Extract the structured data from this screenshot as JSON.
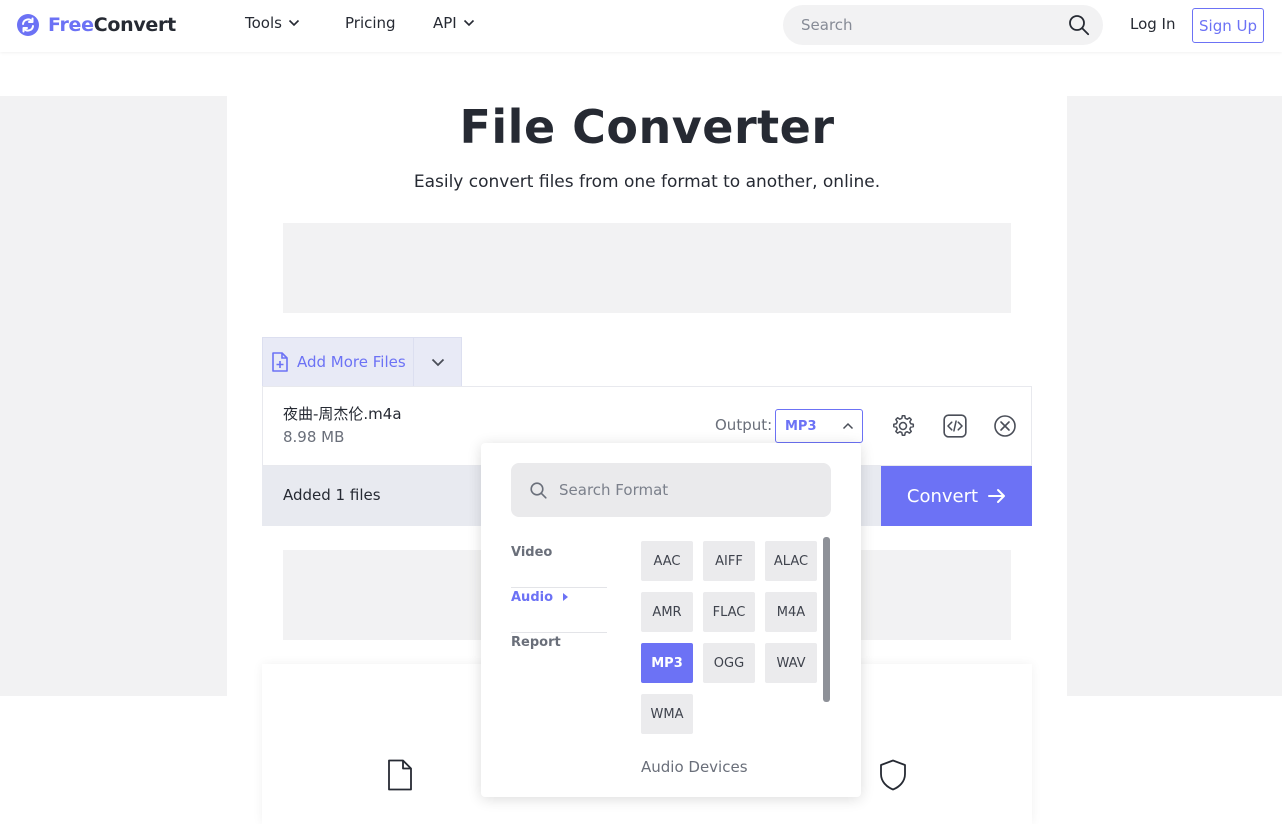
{
  "header": {
    "logo_free": "Free",
    "logo_convert": "Convert",
    "nav": [
      {
        "label": "Tools"
      },
      {
        "label": "Pricing"
      },
      {
        "label": "API"
      }
    ],
    "search_placeholder": "Search",
    "login_label": "Log In",
    "signup_label": "Sign Up"
  },
  "hero": {
    "title": "File Converter",
    "subtitle": "Easily convert files from one format to another, online."
  },
  "uploader": {
    "add_more_label": "Add More Files",
    "file": {
      "name": "夜曲-周杰伦.m4a",
      "size": "8.98 MB"
    },
    "output_label": "Output:",
    "output_value": "MP3",
    "status_text": "Added 1 files",
    "convert_label": "Convert"
  },
  "format_dropdown": {
    "search_placeholder": "Search Format",
    "categories": [
      {
        "label": "Video"
      },
      {
        "label": "Audio"
      },
      {
        "label": "Report"
      }
    ],
    "active_category": "Audio",
    "formats": [
      "AAC",
      "AIFF",
      "ALAC",
      "AMR",
      "FLAC",
      "M4A",
      "MP3",
      "OGG",
      "WAV",
      "WMA"
    ],
    "selected_format": "MP3",
    "next_group_label": "Audio Devices"
  },
  "colors": {
    "accent": "#6c72f5",
    "text": "#262a33",
    "band": "#f2f2f3"
  }
}
